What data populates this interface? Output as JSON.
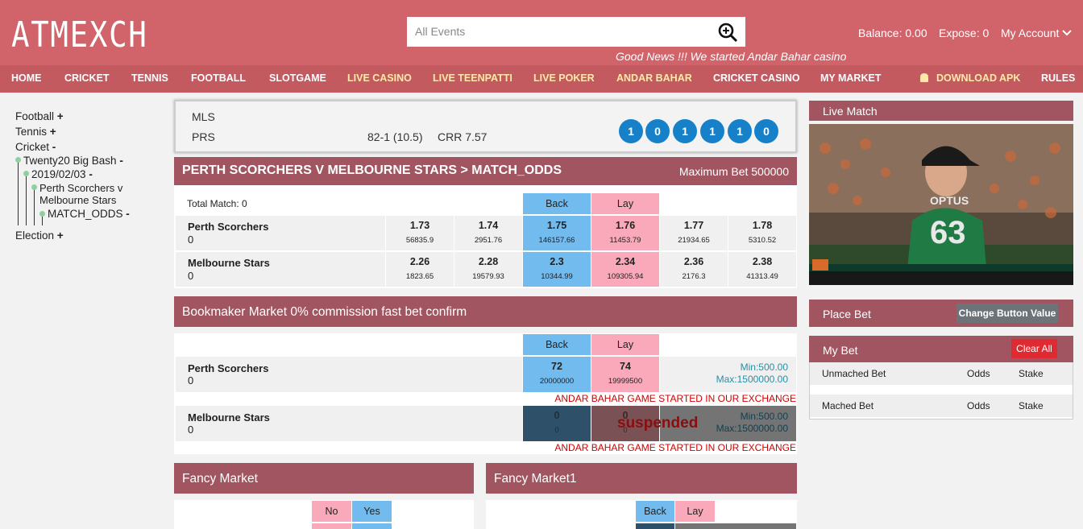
{
  "header": {
    "logo": "ATMEXCH",
    "search_placeholder": "All Events",
    "balance": "Balance: 0.00",
    "expose": "Expose: 0",
    "account": "My Account",
    "news": "Good News !!! We started Andar Bahar casino"
  },
  "nav": [
    {
      "label": "HOME"
    },
    {
      "label": "CRICKET"
    },
    {
      "label": "TENNIS"
    },
    {
      "label": "FOOTBALL"
    },
    {
      "label": "SLOTGAME"
    },
    {
      "label": "LIVE CASINO"
    },
    {
      "label": "LIVE TEENPATTI"
    },
    {
      "label": "LIVE POKER"
    },
    {
      "label": "ANDAR BAHAR"
    },
    {
      "label": "CRICKET CASINO"
    },
    {
      "label": "MY MARKET"
    },
    {
      "label": "DOWNLOAD APK"
    },
    {
      "label": "RULES"
    }
  ],
  "sidebar": {
    "football": "Football",
    "tennis": "Tennis",
    "cricket": "Cricket",
    "bigbash": "Twenty20 Big Bash",
    "date": "2019/02/03",
    "match1": "Perth Scorchers v",
    "match2": "Melbourne Stars",
    "odds": "MATCH_ODDS",
    "election": "Election",
    "plus": "+",
    "minus": "-"
  },
  "score": {
    "team1": "MLS",
    "team2": "PRS",
    "runs": "82-1 (10.5)",
    "crr": "CRR 7.57",
    "balls": [
      "1",
      "0",
      "1",
      "1",
      "1",
      "0"
    ]
  },
  "match": {
    "title": "PERTH SCORCHERS V MELBOURNE STARS > MATCH_ODDS",
    "maxbet": "Maximum Bet 500000",
    "total": "Total Match: 0",
    "back": "Back",
    "lay": "Lay",
    "rows": [
      {
        "name": "Perth Scorchers",
        "pos": "0",
        "odds": [
          [
            "1.73",
            "56835.9"
          ],
          [
            "1.74",
            "2951.76"
          ],
          [
            "1.75",
            "146157.66"
          ],
          [
            "1.76",
            "11453.79"
          ],
          [
            "1.77",
            "21934.65"
          ],
          [
            "1.78",
            "5310.52"
          ]
        ]
      },
      {
        "name": "Melbourne Stars",
        "pos": "0",
        "odds": [
          [
            "2.26",
            "1823.65"
          ],
          [
            "2.28",
            "19579.93"
          ],
          [
            "2.3",
            "10344.99"
          ],
          [
            "2.34",
            "109305.94"
          ],
          [
            "2.36",
            "2176.3"
          ],
          [
            "2.38",
            "41313.49"
          ]
        ]
      }
    ]
  },
  "bookmaker": {
    "title": "Bookmaker Market 0% commission fast bet confirm",
    "back": "Back",
    "lay": "Lay",
    "rows": [
      {
        "name": "Perth Scorchers",
        "pos": "0",
        "back": "72",
        "back_size": "20000000",
        "lay": "74",
        "lay_size": "19999500",
        "min": "Min:500.00",
        "max": "Max:1500000.00",
        "msg": "ANDAR BAHAR GAME STARTED IN OUR EXCHANGE"
      },
      {
        "name": "Melbourne Stars",
        "pos": "0",
        "back": "0",
        "back_size": "0",
        "lay": "0",
        "lay_size": "0",
        "min": "Min:500.00",
        "max": "Max:1500000.00",
        "msg": "ANDAR BAHAR GAME STARTED IN OUR EXCHANGE",
        "status": "suspended"
      }
    ]
  },
  "fancy": {
    "title": "Fancy Market",
    "no": "No",
    "yes": "Yes"
  },
  "fancy1": {
    "title": "Fancy Market1",
    "back": "Back",
    "lay": "Lay"
  },
  "live": {
    "title": "Live Match",
    "jersey": "63",
    "sponsor": "OPTUS"
  },
  "placebet": {
    "title": "Place Bet",
    "button": "Change Button Value"
  },
  "mybet": {
    "title": "My Bet",
    "clear": "Clear All",
    "unmatched": "Unmached Bet",
    "matched": "Mached Bet",
    "odds": "Odds",
    "stake": "Stake"
  },
  "colors": {
    "header": "#d0646a",
    "nav": "#c25a60",
    "bar": "#a05560",
    "back": "#72bbef",
    "lay": "#faa9ba",
    "ball": "#1680c8"
  }
}
